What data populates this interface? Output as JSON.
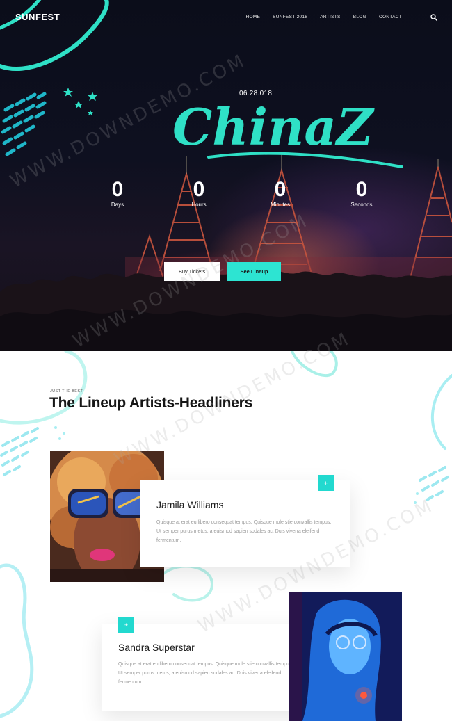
{
  "site": {
    "logo": "SUNFEST",
    "nav": [
      "HOME",
      "SUNFEST 2018",
      "ARTISTS",
      "BLOG",
      "CONTACT"
    ],
    "search_icon": "search-icon"
  },
  "hero": {
    "date": "06.28.018",
    "title": "ChinaZ",
    "countdown": [
      {
        "value": "0",
        "label": "Days"
      },
      {
        "value": "0",
        "label": "Hours"
      },
      {
        "value": "0",
        "label": "Minutes"
      },
      {
        "value": "0",
        "label": "Seconds"
      }
    ],
    "buttons": {
      "tickets": "Buy Tickets",
      "lineup": "See Lineup"
    }
  },
  "lineup": {
    "kicker": "JUST THE BEST",
    "title": "The Lineup Artists-Headliners",
    "artists": [
      {
        "name": "Jamila Williams",
        "bio": "Quisque at erat eu libero consequat tempus. Quisque mole stie convallis tempus. Ut semper purus metus, a euismod sapien sodales ac. Duis viverra eleifend fermentum.",
        "plus": "+"
      },
      {
        "name": "Sandra Superstar",
        "bio": "Quisque at erat eu libero consequat tempus. Quisque mole stie convallis tempus. Ut semper purus metus, a euismod sapien sodales ac. Duis viverra eleifend fermentum.",
        "plus": "+"
      }
    ]
  },
  "watermark": "WWW.DOWNDEMO.COM",
  "colors": {
    "accent": "#2de4d2",
    "dark": "#0b0d1a",
    "text": "#161616"
  }
}
